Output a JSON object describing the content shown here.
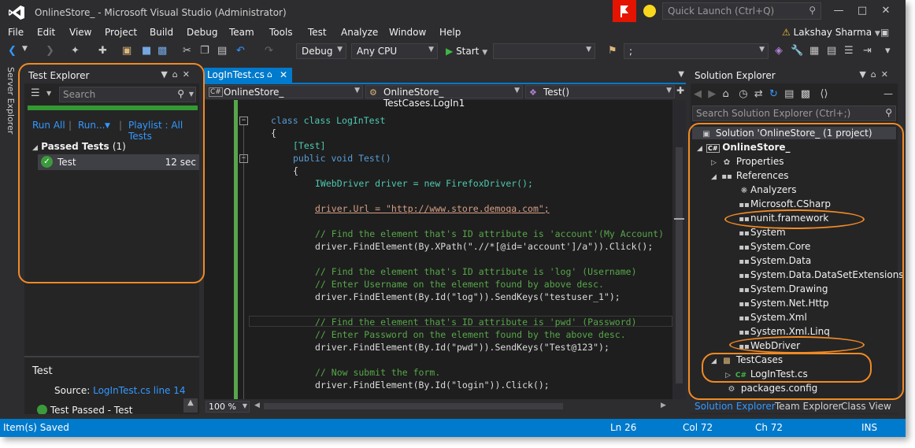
{
  "window": {
    "title": "OnlineStore_  - Microsoft Visual Studio (Administrator)",
    "quick_launch_placeholder": "Quick Launch (Ctrl+Q)",
    "user_name": "Lakshay Sharma"
  },
  "menu": [
    "File",
    "Edit",
    "View",
    "Project",
    "Build",
    "Debug",
    "Team",
    "Tools",
    "Test",
    "Analyze",
    "Window",
    "Help"
  ],
  "toolbar": {
    "config": "Debug",
    "platform": "Any CPU",
    "start_label": "Start",
    "find_value": ";"
  },
  "server_explorer_tab": "Server Explorer",
  "test_explorer": {
    "title": "Test Explorer",
    "search_placeholder": "Search",
    "run_all": "Run All",
    "run": "Run...",
    "playlist": "Playlist : All Tests",
    "group_label": "Passed Tests",
    "group_count": "(1)",
    "tests": [
      {
        "name": "Test",
        "duration": "12 sec"
      }
    ],
    "detail_title": "Test",
    "source_label": "Source:",
    "source_link": "LogInTest.cs line 14",
    "result_text": "Test Passed - Test"
  },
  "editor": {
    "tab": "LogInTest.cs",
    "nav_project": "OnlineStore_",
    "nav_class": "OnlineStore_ TestCases.LogIn1",
    "nav_member": "Test()",
    "zoom": "100 %",
    "code": [
      {
        "text": "class LogInTest"
      },
      {
        "text": "{"
      },
      {
        "text": "[Test]"
      },
      {
        "text": "public void Test()"
      },
      {
        "text": "{"
      },
      {
        "text": "IWebDriver driver = new FirefoxDriver();"
      },
      {
        "text": "driver.Url = \"http://www.store.demoqa.com\";"
      },
      {
        "text": "// Find the element that's ID attribute is 'account'(My Account)"
      },
      {
        "text": "driver.FindElement(By.XPath(\".//*[@id='account']/a\")).Click();"
      },
      {
        "text": "// Find the element that's ID attribute is 'log' (Username)"
      },
      {
        "text": "// Enter Username on the element found by above desc."
      },
      {
        "text": "driver.FindElement(By.Id(\"log\")).SendKeys(\"testuser_1\");"
      },
      {
        "text": "// Find the element that's ID attribute is 'pwd' (Password)"
      },
      {
        "text": "// Enter Password on the element found by the above desc."
      },
      {
        "text": "driver.FindElement(By.Id(\"pwd\")).SendKeys(\"Test@123\");"
      },
      {
        "text": "// Now submit the form."
      },
      {
        "text": "driver.FindElement(By.Id(\"login\")).Click();"
      }
    ]
  },
  "solution_explorer": {
    "title": "Solution Explorer",
    "search_placeholder": "Search Solution Explorer (Ctrl+;)",
    "solution": "Solution 'OnlineStore_  (1 project)",
    "project": "OnlineStore_",
    "properties": "Properties",
    "references": "References",
    "refs": [
      "Analyzers",
      "Microsoft.CSharp",
      "nunit.framework",
      "System",
      "System.Core",
      "System.Data",
      "System.Data.DataSetExtensions",
      "System.Drawing",
      "System.Net.Http",
      "System.Xml",
      "System.Xml.Linq",
      "WebDriver"
    ],
    "test_folder": "TestCases",
    "test_file": "LogInTest.cs",
    "packages": "packages.config",
    "bottom_tabs": [
      "Solution Explorer",
      "Team Explorer",
      "Class View"
    ]
  },
  "status": {
    "message": "Item(s) Saved",
    "ln": "Ln 26",
    "col": "Col 72",
    "ch": "Ch 72",
    "mode": "INS"
  },
  "colors": {
    "accent": "#007acc",
    "annotation": "#f08a24",
    "pass": "#339933"
  }
}
